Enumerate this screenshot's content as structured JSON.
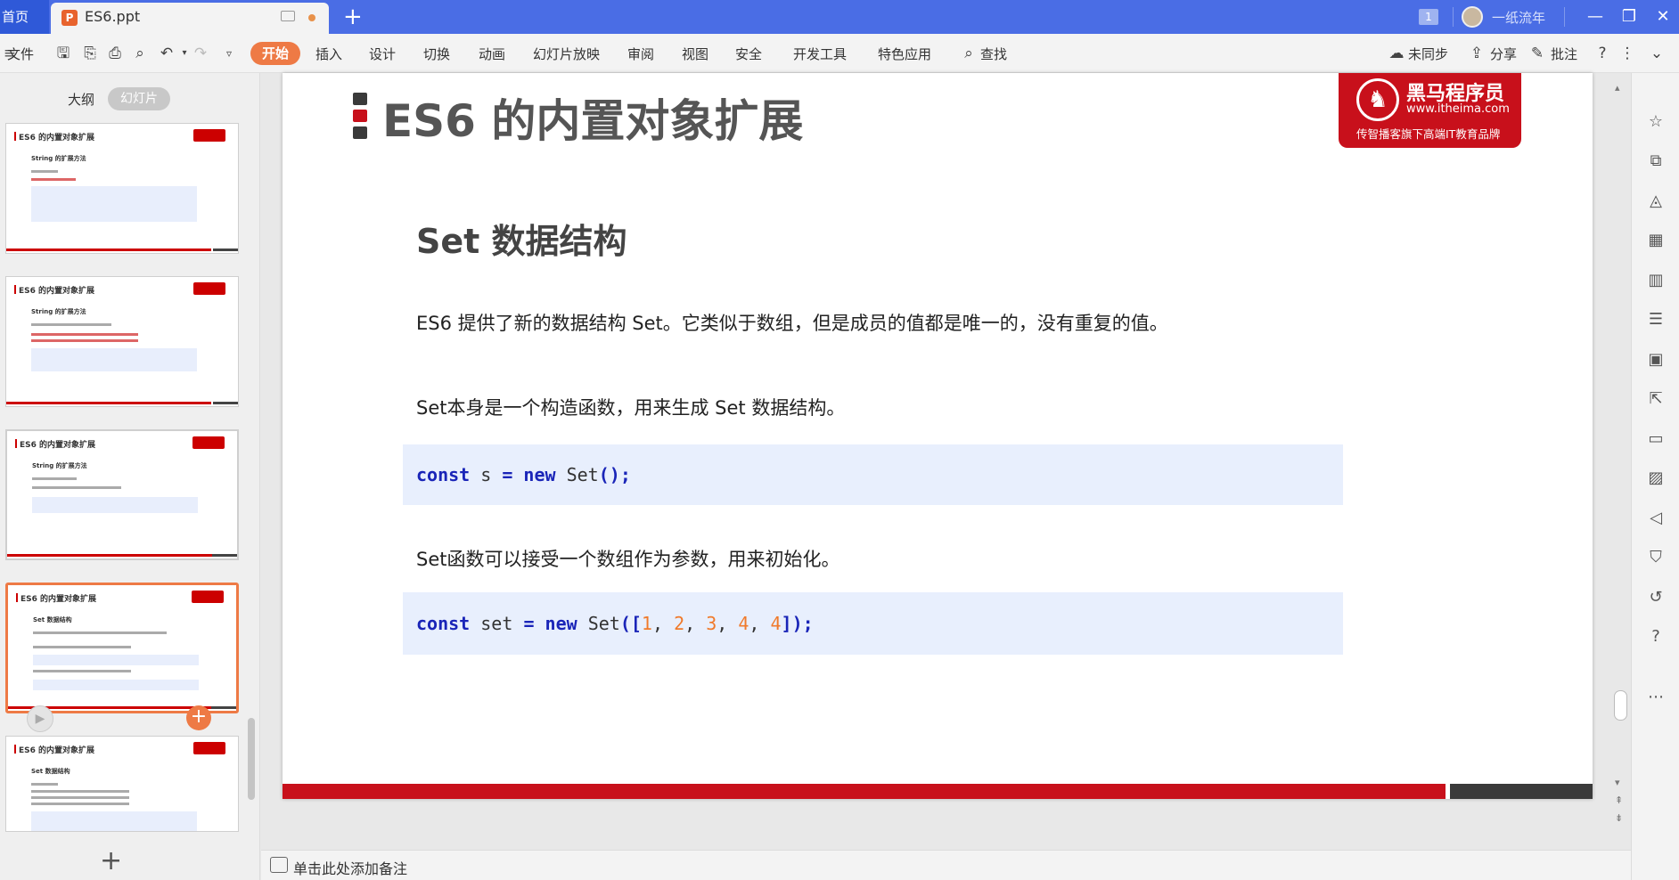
{
  "titlebar": {
    "home_tab": "首页",
    "doc_tab": "ES6.ppt",
    "doc_icon": "P",
    "page_badge": "1",
    "user_name": "一纸流年",
    "minimize": "—",
    "restore": "❐",
    "close": "✕",
    "new_tab": "+"
  },
  "ribbon": {
    "file": "文件",
    "tabs": [
      "开始",
      "插入",
      "设计",
      "切换",
      "动画",
      "幻灯片放映",
      "审阅",
      "视图",
      "安全",
      "开发工具",
      "特色应用"
    ],
    "search": "查找",
    "sync": "未同步",
    "share": "分享",
    "comment": "批注"
  },
  "left_panel": {
    "outline_tab": "大纲",
    "slides_tab": "幻灯片",
    "add_slide": "+",
    "thumbnails": [
      {
        "title": "ES6 的内置对象扩展",
        "subtitle": "String 的扩展方法"
      },
      {
        "title": "ES6 的内置对象扩展",
        "subtitle": "String 的扩展方法"
      },
      {
        "title": "ES6 的内置对象扩展",
        "subtitle": "String 的扩展方法"
      },
      {
        "title": "ES6 的内置对象扩展",
        "subtitle": "Set 数据结构"
      },
      {
        "title": "ES6 的内置对象扩展",
        "subtitle": "Set 数据结构"
      }
    ]
  },
  "slide": {
    "title": "ES6 的内置对象扩展",
    "logo_name": "黑马程序员",
    "logo_url": "www.itheima.com",
    "logo_tag": "传智播客旗下高端IT教育品牌",
    "heading": "Set 数据结构",
    "para1": "ES6 提供了新的数据结构  Set。它类似于数组，但是成员的值都是唯一的，没有重复的值。",
    "para2": "Set本身是一个构造函数，用来生成  Set  数据结构。",
    "code1": {
      "kw1": "const",
      "var": " s ",
      "op": "=",
      "kw2": " new",
      "rest": " Set",
      "paren": "();"
    },
    "para3": "Set函数可以接受一个数组作为参数，用来初始化。",
    "code2": {
      "kw1": "const",
      "var": " set ",
      "op": "=",
      "kw2": " new",
      "rest": " Set",
      "open": "([",
      "n1": "1",
      "n2": "2",
      "n3": "3",
      "n4": "4",
      "n5": "4",
      "close": "]);"
    }
  },
  "notes": {
    "placeholder": "单击此处添加备注"
  },
  "colors": {
    "titlebar": "#4a6de5",
    "accent": "#ee7a45",
    "brand_red": "#c8101b",
    "code_kw": "#1a25b8",
    "code_num": "#f07a2b"
  }
}
